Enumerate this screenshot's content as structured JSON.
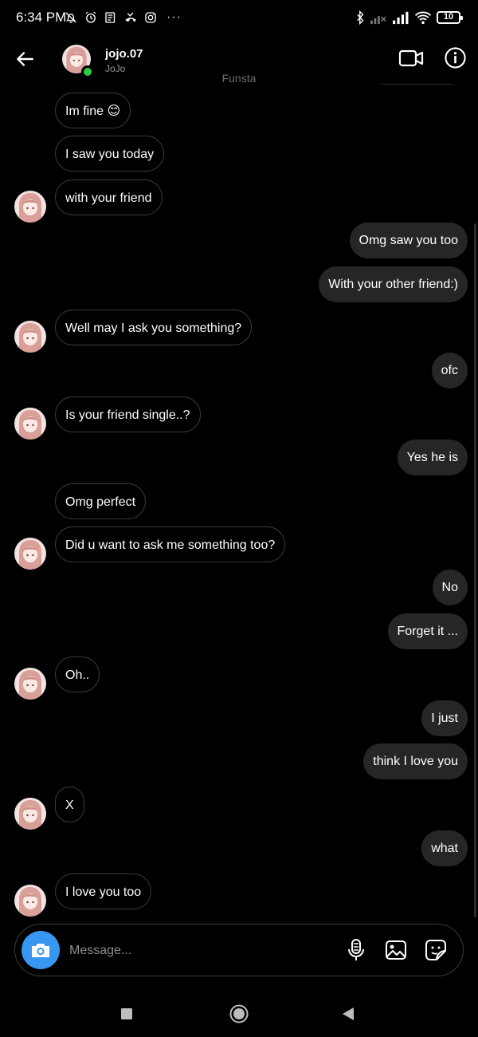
{
  "status_bar": {
    "time": "6:34 PM",
    "battery": "10",
    "left_icons": [
      "mute-bell-icon",
      "alarm-icon",
      "news-icon",
      "missed-call-icon",
      "instagram-icon"
    ],
    "overflow": "···",
    "right_icons": [
      "bluetooth-icon",
      "signal-off-icon",
      "signal-icon",
      "wifi-icon",
      "battery-icon"
    ]
  },
  "header": {
    "username": "jojo.07",
    "display_name": "JoJo",
    "subtitle": "Funsta",
    "online": true,
    "online_color": "#2ecc40"
  },
  "messages": [
    {
      "from": "them",
      "text": "Im fine 😊",
      "avatar": false
    },
    {
      "from": "them",
      "text": "I saw you today",
      "avatar": false
    },
    {
      "from": "them",
      "text": "with your friend",
      "avatar": true
    },
    {
      "from": "me",
      "text": "Omg saw you too"
    },
    {
      "from": "me",
      "text": "With your other friend:)"
    },
    {
      "from": "them",
      "text": "Well may I ask you something?",
      "avatar": true
    },
    {
      "from": "me",
      "text": "ofc"
    },
    {
      "from": "them",
      "text": "Is your friend single..?",
      "avatar": true
    },
    {
      "from": "me",
      "text": "Yes he is"
    },
    {
      "from": "them",
      "text": "Omg perfect",
      "avatar": false
    },
    {
      "from": "them",
      "text": "Did u want to ask me something too?",
      "avatar": true
    },
    {
      "from": "me",
      "text": "No"
    },
    {
      "from": "me",
      "text": "Forget it ..."
    },
    {
      "from": "them",
      "text": "Oh..",
      "avatar": true
    },
    {
      "from": "me",
      "text": "I just"
    },
    {
      "from": "me",
      "text": "think I love you"
    },
    {
      "from": "them",
      "text": "X",
      "avatar": true
    },
    {
      "from": "me",
      "text": "what"
    },
    {
      "from": "them",
      "text": "I love you too",
      "avatar": true
    }
  ],
  "composer": {
    "placeholder": "Message...",
    "camera_color": "#3897f0",
    "icons": [
      "microphone-icon",
      "gallery-icon",
      "sticker-icon"
    ]
  },
  "nav_bar": {
    "buttons": [
      "recents-button",
      "home-button",
      "back-nav-button"
    ]
  }
}
